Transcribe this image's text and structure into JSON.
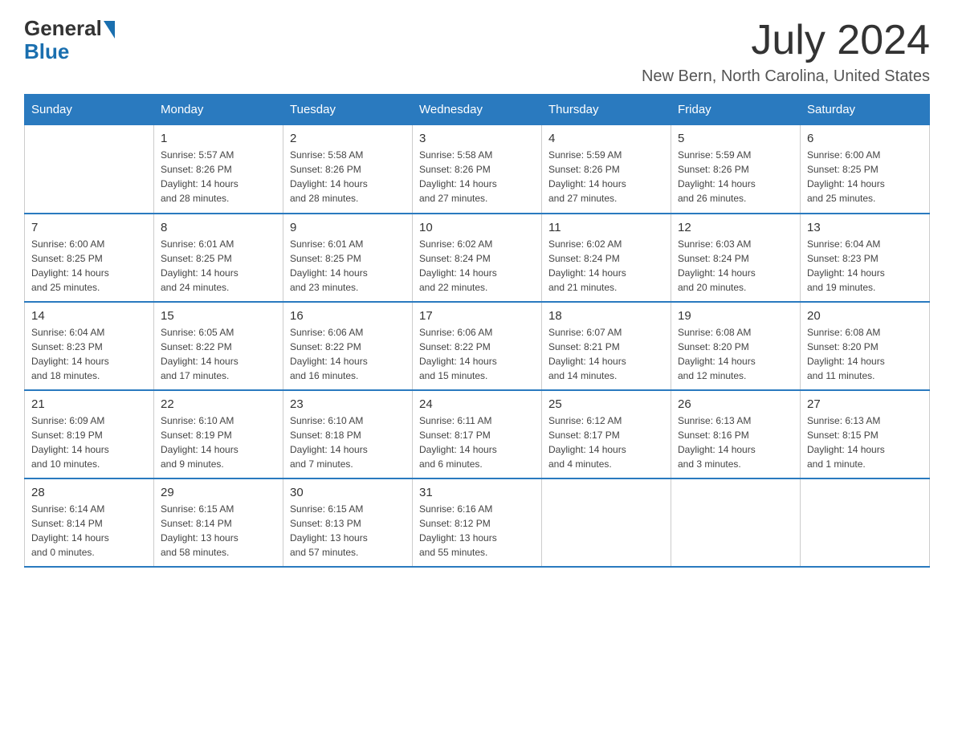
{
  "header": {
    "logo": {
      "text_general": "General",
      "text_blue": "Blue"
    },
    "title": "July 2024",
    "location": "New Bern, North Carolina, United States"
  },
  "weekdays": [
    "Sunday",
    "Monday",
    "Tuesday",
    "Wednesday",
    "Thursday",
    "Friday",
    "Saturday"
  ],
  "weeks": [
    [
      {
        "day": "",
        "info": ""
      },
      {
        "day": "1",
        "info": "Sunrise: 5:57 AM\nSunset: 8:26 PM\nDaylight: 14 hours\nand 28 minutes."
      },
      {
        "day": "2",
        "info": "Sunrise: 5:58 AM\nSunset: 8:26 PM\nDaylight: 14 hours\nand 28 minutes."
      },
      {
        "day": "3",
        "info": "Sunrise: 5:58 AM\nSunset: 8:26 PM\nDaylight: 14 hours\nand 27 minutes."
      },
      {
        "day": "4",
        "info": "Sunrise: 5:59 AM\nSunset: 8:26 PM\nDaylight: 14 hours\nand 27 minutes."
      },
      {
        "day": "5",
        "info": "Sunrise: 5:59 AM\nSunset: 8:26 PM\nDaylight: 14 hours\nand 26 minutes."
      },
      {
        "day": "6",
        "info": "Sunrise: 6:00 AM\nSunset: 8:25 PM\nDaylight: 14 hours\nand 25 minutes."
      }
    ],
    [
      {
        "day": "7",
        "info": "Sunrise: 6:00 AM\nSunset: 8:25 PM\nDaylight: 14 hours\nand 25 minutes."
      },
      {
        "day": "8",
        "info": "Sunrise: 6:01 AM\nSunset: 8:25 PM\nDaylight: 14 hours\nand 24 minutes."
      },
      {
        "day": "9",
        "info": "Sunrise: 6:01 AM\nSunset: 8:25 PM\nDaylight: 14 hours\nand 23 minutes."
      },
      {
        "day": "10",
        "info": "Sunrise: 6:02 AM\nSunset: 8:24 PM\nDaylight: 14 hours\nand 22 minutes."
      },
      {
        "day": "11",
        "info": "Sunrise: 6:02 AM\nSunset: 8:24 PM\nDaylight: 14 hours\nand 21 minutes."
      },
      {
        "day": "12",
        "info": "Sunrise: 6:03 AM\nSunset: 8:24 PM\nDaylight: 14 hours\nand 20 minutes."
      },
      {
        "day": "13",
        "info": "Sunrise: 6:04 AM\nSunset: 8:23 PM\nDaylight: 14 hours\nand 19 minutes."
      }
    ],
    [
      {
        "day": "14",
        "info": "Sunrise: 6:04 AM\nSunset: 8:23 PM\nDaylight: 14 hours\nand 18 minutes."
      },
      {
        "day": "15",
        "info": "Sunrise: 6:05 AM\nSunset: 8:22 PM\nDaylight: 14 hours\nand 17 minutes."
      },
      {
        "day": "16",
        "info": "Sunrise: 6:06 AM\nSunset: 8:22 PM\nDaylight: 14 hours\nand 16 minutes."
      },
      {
        "day": "17",
        "info": "Sunrise: 6:06 AM\nSunset: 8:22 PM\nDaylight: 14 hours\nand 15 minutes."
      },
      {
        "day": "18",
        "info": "Sunrise: 6:07 AM\nSunset: 8:21 PM\nDaylight: 14 hours\nand 14 minutes."
      },
      {
        "day": "19",
        "info": "Sunrise: 6:08 AM\nSunset: 8:20 PM\nDaylight: 14 hours\nand 12 minutes."
      },
      {
        "day": "20",
        "info": "Sunrise: 6:08 AM\nSunset: 8:20 PM\nDaylight: 14 hours\nand 11 minutes."
      }
    ],
    [
      {
        "day": "21",
        "info": "Sunrise: 6:09 AM\nSunset: 8:19 PM\nDaylight: 14 hours\nand 10 minutes."
      },
      {
        "day": "22",
        "info": "Sunrise: 6:10 AM\nSunset: 8:19 PM\nDaylight: 14 hours\nand 9 minutes."
      },
      {
        "day": "23",
        "info": "Sunrise: 6:10 AM\nSunset: 8:18 PM\nDaylight: 14 hours\nand 7 minutes."
      },
      {
        "day": "24",
        "info": "Sunrise: 6:11 AM\nSunset: 8:17 PM\nDaylight: 14 hours\nand 6 minutes."
      },
      {
        "day": "25",
        "info": "Sunrise: 6:12 AM\nSunset: 8:17 PM\nDaylight: 14 hours\nand 4 minutes."
      },
      {
        "day": "26",
        "info": "Sunrise: 6:13 AM\nSunset: 8:16 PM\nDaylight: 14 hours\nand 3 minutes."
      },
      {
        "day": "27",
        "info": "Sunrise: 6:13 AM\nSunset: 8:15 PM\nDaylight: 14 hours\nand 1 minute."
      }
    ],
    [
      {
        "day": "28",
        "info": "Sunrise: 6:14 AM\nSunset: 8:14 PM\nDaylight: 14 hours\nand 0 minutes."
      },
      {
        "day": "29",
        "info": "Sunrise: 6:15 AM\nSunset: 8:14 PM\nDaylight: 13 hours\nand 58 minutes."
      },
      {
        "day": "30",
        "info": "Sunrise: 6:15 AM\nSunset: 8:13 PM\nDaylight: 13 hours\nand 57 minutes."
      },
      {
        "day": "31",
        "info": "Sunrise: 6:16 AM\nSunset: 8:12 PM\nDaylight: 13 hours\nand 55 minutes."
      },
      {
        "day": "",
        "info": ""
      },
      {
        "day": "",
        "info": ""
      },
      {
        "day": "",
        "info": ""
      }
    ]
  ]
}
